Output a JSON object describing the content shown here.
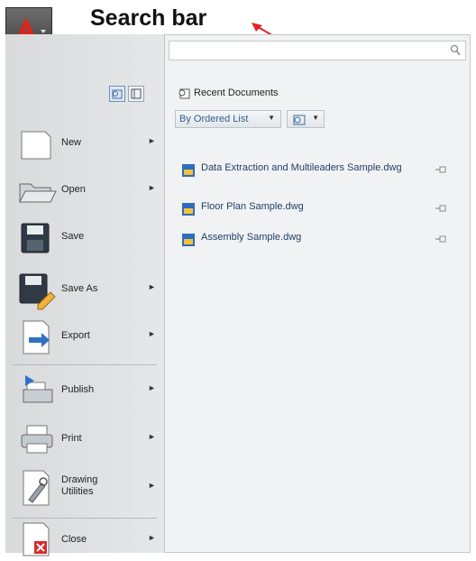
{
  "annotation": {
    "label": "Search bar"
  },
  "search": {
    "placeholder": "",
    "icon": "magnifier-icon"
  },
  "menu": {
    "items": [
      {
        "label": "New",
        "icon": "new-document-icon",
        "submenu": true
      },
      {
        "label": "Open",
        "icon": "open-folder-icon",
        "submenu": true
      },
      {
        "label": "Save",
        "icon": "save-disk-icon",
        "submenu": false
      },
      {
        "label": "Save As",
        "icon": "save-as-icon",
        "submenu": true
      },
      {
        "label": "Export",
        "icon": "export-icon",
        "submenu": true
      },
      {
        "label": "Publish",
        "icon": "publish-icon",
        "submenu": true
      },
      {
        "label": "Print",
        "icon": "printer-icon",
        "submenu": true
      },
      {
        "label": "Drawing Utilities",
        "icon": "drawing-utilities-icon",
        "submenu": true
      },
      {
        "label": "Close",
        "icon": "close-document-icon",
        "submenu": true
      }
    ]
  },
  "recent": {
    "title": "Recent Documents",
    "sort_label": "By Ordered List",
    "documents": [
      {
        "name": "Data Extraction and Multileaders Sample.dwg",
        "pinned": false
      },
      {
        "name": "Floor Plan Sample.dwg",
        "pinned": false
      },
      {
        "name": "Assembly Sample.dwg",
        "pinned": false
      }
    ]
  },
  "colors": {
    "accent": "#d7261e",
    "annotation_arrow": "#e0262a",
    "link_text": "#1f3f6a"
  }
}
